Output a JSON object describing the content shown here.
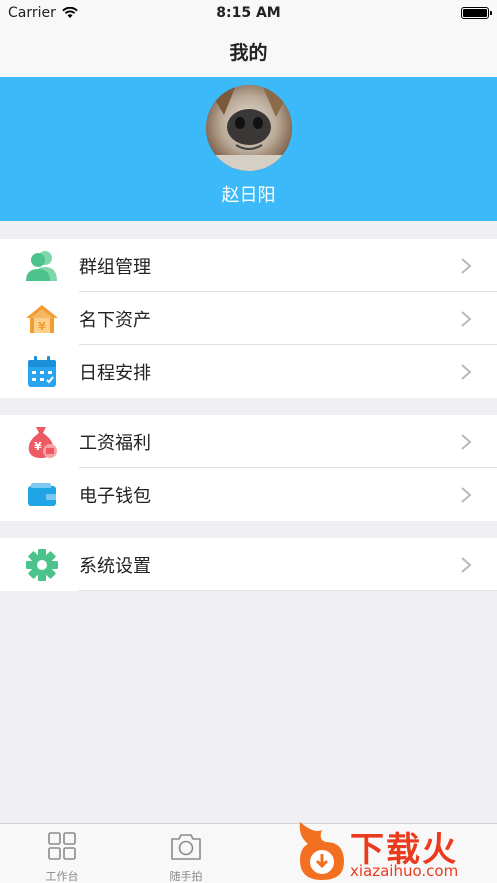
{
  "status_bar": {
    "carrier": "Carrier",
    "time": "8:15 AM"
  },
  "nav": {
    "title": "我的"
  },
  "profile": {
    "name": "赵日阳",
    "background": "#3cb9f8"
  },
  "sections": [
    {
      "items": [
        {
          "label": "群组管理",
          "icon": "group-icon",
          "color": "#4cc38a"
        },
        {
          "label": "名下资产",
          "icon": "house-yen-icon",
          "color": "#f39c32"
        },
        {
          "label": "日程安排",
          "icon": "calendar-icon",
          "color": "#2aa4ee"
        }
      ]
    },
    {
      "items": [
        {
          "label": "工资福利",
          "icon": "money-bag-icon",
          "color": "#ee5a64"
        },
        {
          "label": "电子钱包",
          "icon": "wallet-icon",
          "color": "#1fa4e6"
        }
      ]
    },
    {
      "items": [
        {
          "label": "系统设置",
          "icon": "gear-icon",
          "color": "#4cc38a"
        }
      ]
    }
  ],
  "tab_bar": {
    "tabs": [
      {
        "label": "工作台",
        "icon": "grid-icon"
      },
      {
        "label": "随手拍",
        "icon": "camera-icon"
      }
    ]
  },
  "watermark": {
    "title": "下载火",
    "url": "xiazaihuo.com"
  }
}
